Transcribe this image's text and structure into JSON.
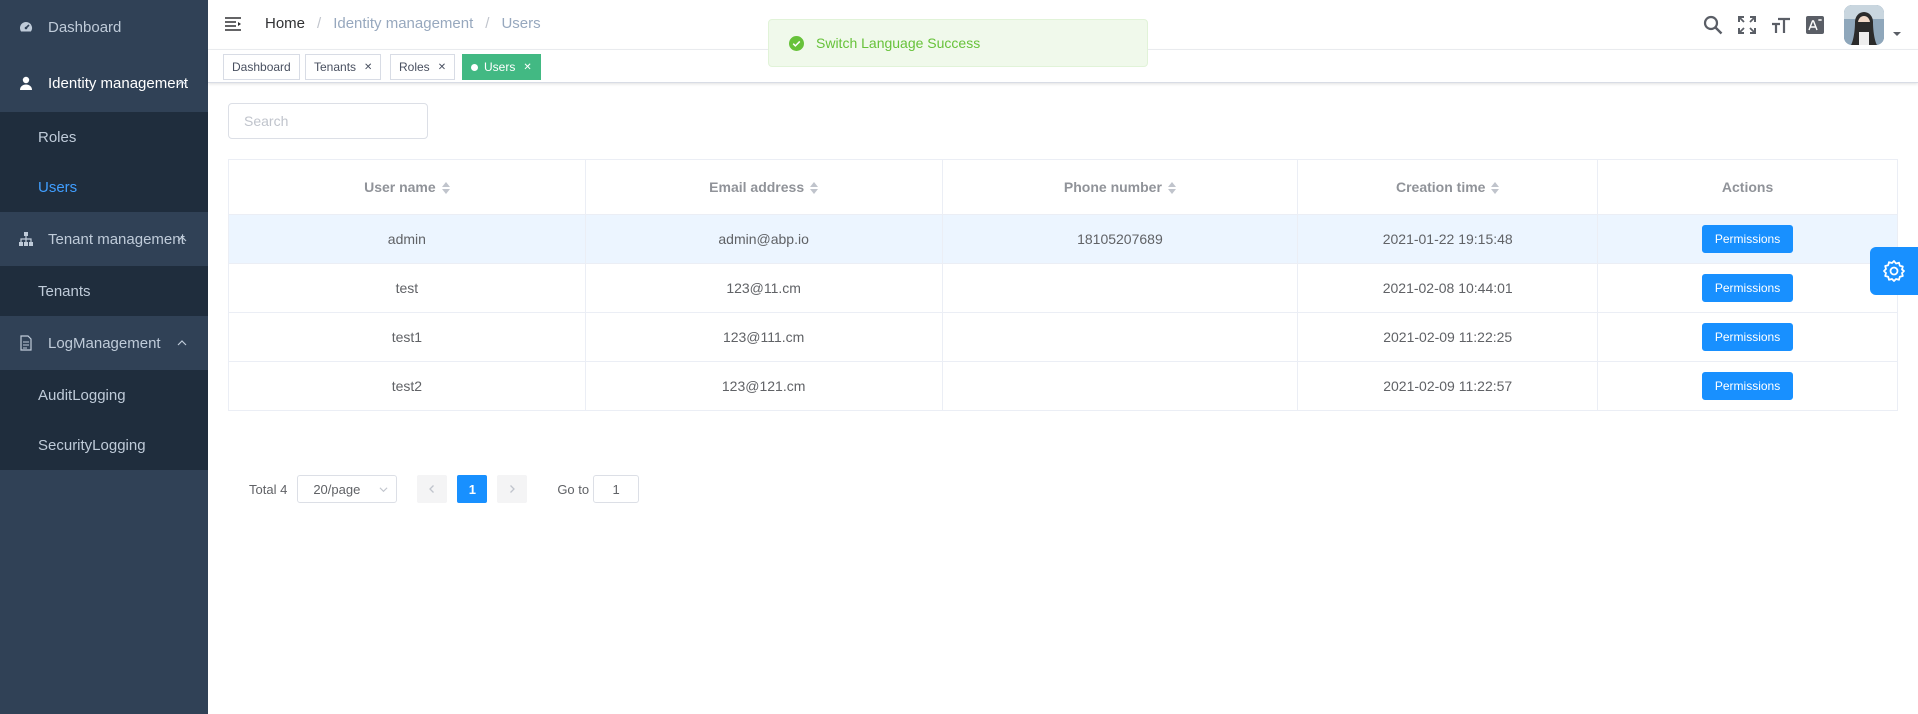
{
  "sidebar": {
    "dashboard": "Dashboard",
    "identity": {
      "label": "Identity management",
      "items": [
        "Roles",
        "Users"
      ]
    },
    "tenant": {
      "label": "Tenant management",
      "items": [
        "Tenants"
      ]
    },
    "log": {
      "label": "LogManagement",
      "items": [
        "AuditLogging",
        "SecurityLogging"
      ]
    }
  },
  "breadcrumb": {
    "home": "Home",
    "level1": "Identity management",
    "level2": "Users",
    "separator": "/"
  },
  "tags": [
    {
      "label": "Dashboard",
      "closable": false
    },
    {
      "label": "Tenants",
      "closable": true
    },
    {
      "label": "Roles",
      "closable": true
    },
    {
      "label": "Users",
      "closable": true,
      "active": true
    }
  ],
  "toast": {
    "message": "Switch Language Success",
    "type": "success"
  },
  "search": {
    "placeholder": "Search",
    "value": ""
  },
  "table": {
    "columns": [
      "User name",
      "Email address",
      "Phone number",
      "Creation time",
      "Actions"
    ],
    "rows": [
      {
        "user": "admin",
        "email": "admin@abp.io",
        "phone": "18105207689",
        "created": "2021-01-22 19:15:48",
        "action": "Permissions",
        "highlighted": true
      },
      {
        "user": "test",
        "email": "123@11.cm",
        "phone": "",
        "created": "2021-02-08 10:44:01",
        "action": "Permissions"
      },
      {
        "user": "test1",
        "email": "123@111.cm",
        "phone": "",
        "created": "2021-02-09 11:22:25",
        "action": "Permissions"
      },
      {
        "user": "test2",
        "email": "123@121.cm",
        "phone": "",
        "created": "2021-02-09 11:22:57",
        "action": "Permissions"
      }
    ]
  },
  "pagination": {
    "total": "Total 4",
    "page_size": "20/page",
    "current_page": "1",
    "goto_label": "Go to",
    "goto_value": "1"
  },
  "colors": {
    "sidebar_bg": "#304156",
    "submenu_bg": "#1f2d3d",
    "primary": "#1890ff",
    "active_tag": "#42b983",
    "toast_bg": "#f0f9eb"
  }
}
